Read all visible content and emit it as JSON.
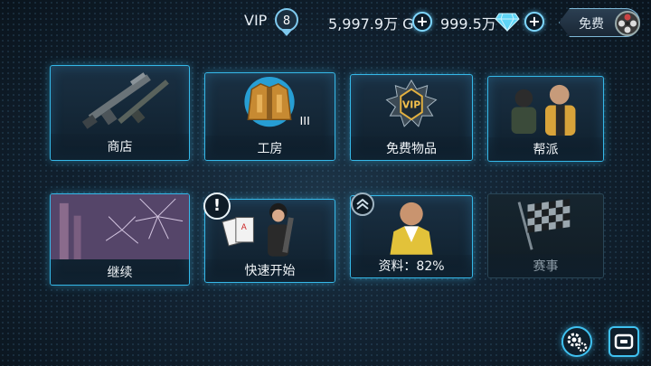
{
  "topbar": {
    "vip_label": "VIP",
    "vip_level": "8",
    "gold_amount": "5,997.9万 G",
    "gem_amount": "999.5万",
    "free_label": "免费",
    "icons": [
      "vip-shield-icon",
      "plus-icon",
      "diamond-icon",
      "film-reel-icon"
    ]
  },
  "tiles": [
    {
      "label": "商店",
      "icon": "weapons-icon"
    },
    {
      "label": "工房",
      "icon": "armor-jacket-icon",
      "tier": "III"
    },
    {
      "label": "免费物品",
      "icon": "vip-emblem-icon"
    },
    {
      "label": "帮派",
      "icon": "gang-members-icon"
    },
    {
      "label": "继续",
      "icon": "fireworks-icon"
    },
    {
      "label": "快速开始",
      "icon": "agent-cards-icon"
    },
    {
      "label": "资料：82%",
      "icon": "player-profile-icon"
    },
    {
      "label": "赛事",
      "icon": "checkered-flag-icon"
    }
  ],
  "badges": {
    "alert": "!"
  },
  "bottom": {
    "icons": [
      "settings-gears-icon",
      "gameloft-connect-icon"
    ]
  },
  "colors": {
    "accent": "#35b8e8",
    "background": "#122231"
  }
}
